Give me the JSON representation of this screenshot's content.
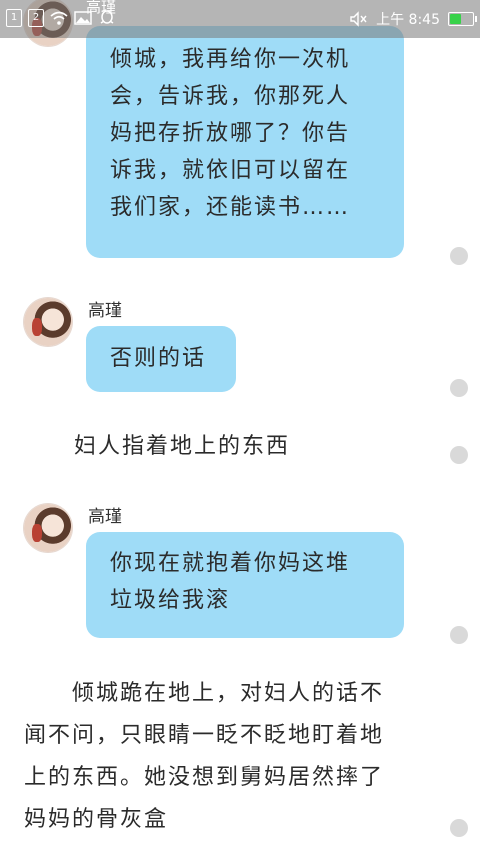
{
  "status_bar": {
    "sim1": "1",
    "sim2": "2",
    "peek_name": "高瑾",
    "time": "上午 8:45",
    "battery_level": 0.45,
    "battery_color": "#38d24a",
    "icons": [
      "wifi-icon",
      "image-icon",
      "qq-icon",
      "mute-icon"
    ]
  },
  "messages": [
    {
      "type": "bubble",
      "speaker": "",
      "lines": [
        "倾城，我再给你一次机",
        "会，告诉我，你那死人",
        "妈把存折放哪了？你告",
        "诉我，就依旧可以留在",
        "我们家，还能读书……"
      ]
    },
    {
      "type": "bubble",
      "speaker": "高瑾",
      "lines": [
        "否则的话"
      ]
    },
    {
      "type": "narration",
      "lines": [
        "妇人指着地上的东西"
      ]
    },
    {
      "type": "bubble",
      "speaker": "高瑾",
      "lines": [
        "你现在就抱着你妈这堆",
        "垃圾给我滚"
      ]
    },
    {
      "type": "narration",
      "lines": [
        "　　倾城跪在地上，对妇人的话不",
        "闻不问，只眼睛一眨不眨地盯着地",
        "上的东西。她没想到舅妈居然摔了",
        "妈妈的骨灰盒"
      ]
    }
  ],
  "colors": {
    "bubble_bg": "#9fdcf7",
    "dot": "#d9d9d9"
  }
}
